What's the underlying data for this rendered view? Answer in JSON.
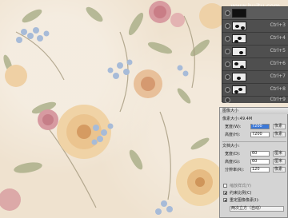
{
  "watermark": "www.huitu.com",
  "colors": {
    "accent": "#3b78d8",
    "panel_bg": "#4a4a4a",
    "dialog_bg": "#d4d4d4"
  },
  "layers": {
    "items": [
      {
        "shortcut": "",
        "thumb": "black"
      },
      {
        "shortcut": "Ctrl+3",
        "thumb": "light"
      },
      {
        "shortcut": "Ctrl+4",
        "thumb": "light"
      },
      {
        "shortcut": "Ctrl+5",
        "thumb": "light"
      },
      {
        "shortcut": "Ctrl+6",
        "thumb": "light"
      },
      {
        "shortcut": "Ctrl+7",
        "thumb": "light"
      },
      {
        "shortcut": "Ctrl+8",
        "thumb": "light"
      },
      {
        "shortcut": "Ctrl+9",
        "thumb": "light"
      }
    ]
  },
  "image_size_dialog": {
    "title": "图像大小",
    "pixel_size_label": "像素大小:49.4M",
    "width_label": "宽度(W):",
    "width_value": "7200",
    "height_label": "高度(H):",
    "height_value": "7200",
    "pixel_unit": "像素",
    "doc_size_label": "文档大小:",
    "doc_width_label": "宽度(D):",
    "doc_width_value": "60",
    "doc_height_label": "高度(G):",
    "doc_height_value": "60",
    "resolution_label": "分辨率(R):",
    "resolution_value": "120",
    "doc_unit": "厘米",
    "res_unit": "像素",
    "scale_styles_label": "缩放样式(Y)",
    "constrain_label": "约束比例(C)",
    "resample_label": "重定图像像素(I):",
    "resample_value": "两次立方（自动）"
  }
}
